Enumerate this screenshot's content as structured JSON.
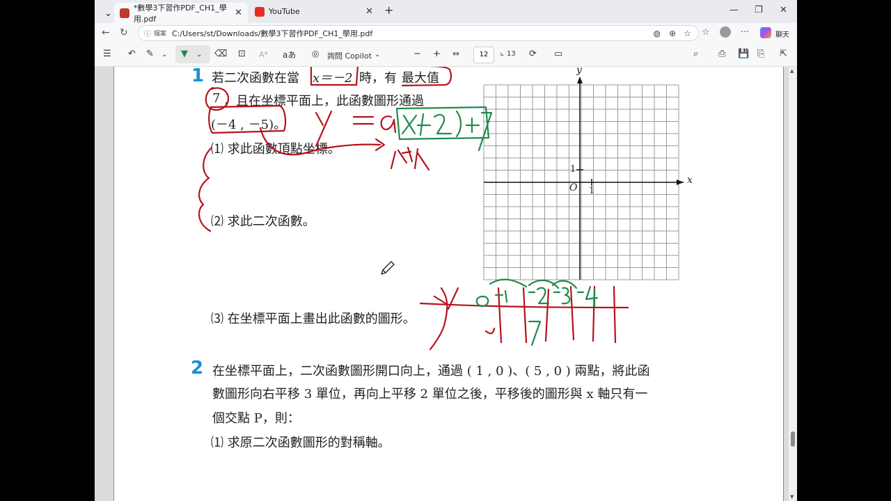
{
  "tabs": [
    {
      "label": "*數學3下習作PDF_CH1_學用.pdf",
      "active": true
    },
    {
      "label": "YouTube",
      "active": false
    }
  ],
  "address": {
    "badge": "檔案",
    "url": "C:/Users/st/Downloads/數學3下習作PDF_CH1_學用.pdf",
    "chat_label": "聊天"
  },
  "pdf_toolbar": {
    "copilot_label": "詢問 Copilot",
    "current_page": "12",
    "total_pages": "13",
    "aa_label": "aあ"
  },
  "document": {
    "q1": {
      "number": "1",
      "line1_a": "若二次函數在當",
      "line1_x": "x＝－2",
      "line1_b": "時，有",
      "line1_c": "最大值",
      "line2_a": "7",
      "line2_b": "，且在坐標平面上，此函數圖形通過",
      "line3": "(－4 , －5)。",
      "sub1": "⑴  求此函數頂點坐標。",
      "sub2": "⑵  求此二次函數。",
      "sub3": "⑶  在坐標平面上畫出此函數的圖形。"
    },
    "graph": {
      "y_label": "y",
      "x_label": "x",
      "origin": "O",
      "tick_y": "1",
      "tick_x": "1"
    },
    "q2": {
      "number": "2",
      "line1": "在坐標平面上，二次函數圖形開口向上，通過 ( 1 , 0 )、( 5 , 0 ) 兩點，將此函",
      "line2": "數圖形向右平移 3 單位，再向上平移 2 單位之後，平移後的圖形與 x 軸只有一",
      "line3": "個交點 P，則：",
      "sub1": "⑴  求原二次函數圖形的對稱軸。"
    }
  },
  "colors": {
    "annotation_red": "#b5121b",
    "annotation_green": "#1f8a4c",
    "question_number": "#1a8fd6"
  }
}
